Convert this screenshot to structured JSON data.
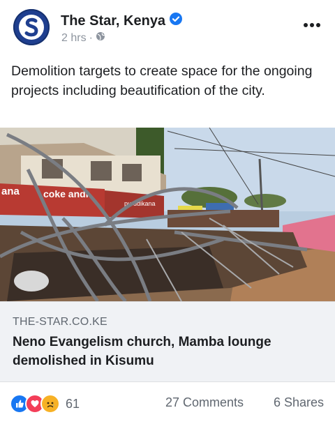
{
  "post": {
    "page_name": "The Star, Kenya",
    "time": "2 hrs",
    "separator": "·",
    "text": "Demolition targets to create space for the ongoing projects including beautification of the city.",
    "image_alt": "Demolished structures in Kisumu",
    "sign_texts": [
      "ana",
      "coke andi",
      "purudikana"
    ]
  },
  "link_preview": {
    "domain": "THE-STAR.CO.KE",
    "title": "Neno Evangelism church, Mamba lounge demolished in Kisumu"
  },
  "footer": {
    "reaction_icons": [
      "like-icon",
      "love-icon",
      "sad-icon"
    ],
    "reaction_count": "61",
    "comments": "27 Comments",
    "shares": "6 Shares"
  },
  "colors": {
    "brand": "#1f3f8f",
    "verified": "#1877f2",
    "like": "#1877f2",
    "love": "#f33e58",
    "sad": "#f7b125"
  }
}
